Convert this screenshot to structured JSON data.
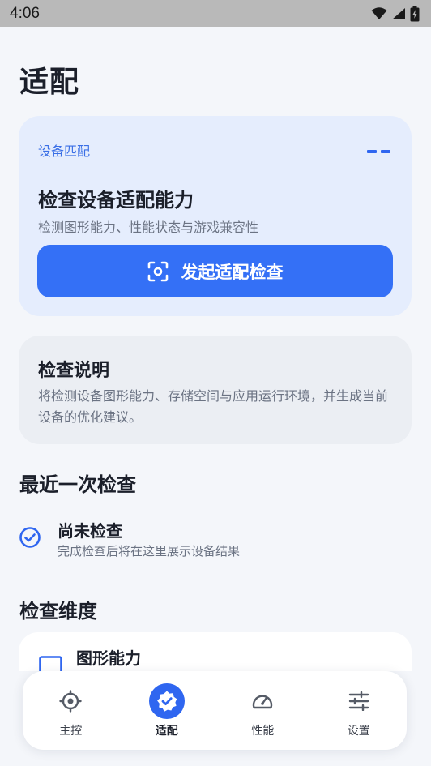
{
  "status_bar": {
    "time": "4:06"
  },
  "page": {
    "title": "适配"
  },
  "hero_card": {
    "eyebrow": "设备匹配",
    "title": "检查设备适配能力",
    "description": "检测图形能力、性能状态与游戏兼容性",
    "button_label": "发起适配检查"
  },
  "info_card": {
    "title": "检查说明",
    "body": "将检测设备图形能力、存储空间与应用运行环境，并生成当前设备的优化建议。"
  },
  "recent": {
    "section_title": "最近一次检查",
    "status_title": "尚未检查",
    "status_subtitle": "完成检查后将在这里展示设备结果"
  },
  "dimensions": {
    "section_title": "检查维度",
    "items": [
      {
        "title": "图形能力",
        "icon": "monitor-icon"
      }
    ]
  },
  "bottom_nav": {
    "items": [
      {
        "label": "主控",
        "icon": "crosshair-icon",
        "active": false
      },
      {
        "label": "适配",
        "icon": "verified-badge-icon",
        "active": true
      },
      {
        "label": "性能",
        "icon": "speedometer-icon",
        "active": false
      },
      {
        "label": "设置",
        "icon": "sliders-icon",
        "active": false
      }
    ]
  },
  "colors": {
    "accent": "#3470f6",
    "hero_background": "#e5edfd",
    "info_background": "#ebeef3",
    "page_background": "#f4f6fa"
  }
}
